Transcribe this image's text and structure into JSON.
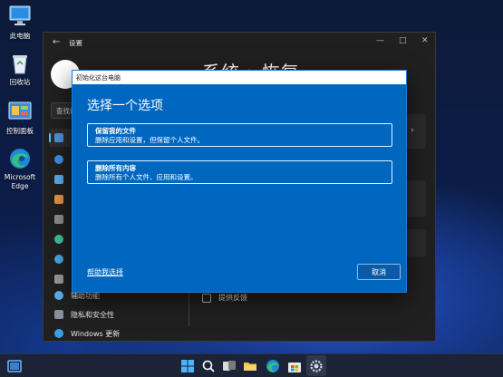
{
  "desktop": {
    "icons": [
      {
        "label": "此电脑",
        "icon": "computer-icon"
      },
      {
        "label": "回收站",
        "icon": "recycle-bin-icon"
      },
      {
        "label": "控制面板",
        "icon": "control-panel-icon"
      },
      {
        "label": "Microsoft Edge",
        "icon": "edge-icon"
      }
    ]
  },
  "settings_window": {
    "title": "设置",
    "heading": "系统 › 恢复",
    "search_value": "查找设",
    "nav_items": [
      {
        "label": "辅助功能",
        "icon": "accessibility-icon"
      },
      {
        "label": "隐私和安全性",
        "icon": "shield-icon"
      },
      {
        "label": "Windows 更新",
        "icon": "windows-update-icon"
      }
    ],
    "feedback_label": "提供反馈",
    "colors": {
      "background": "#202020",
      "accent": "#4cc2ff"
    }
  },
  "dialog": {
    "titlebar": "初始化这台电脑",
    "heading": "选择一个选项",
    "options": [
      {
        "title": "保留我的文件",
        "desc": "删除应用和设置，但保留个人文件。"
      },
      {
        "title": "删除所有内容",
        "desc": "删除所有个人文件、应用和设置。"
      }
    ],
    "help_link": "帮助我选择",
    "cancel_label": "取消",
    "colors": {
      "background": "#0067c0"
    }
  },
  "taskbar": {
    "icons": [
      "show-desktop-icon",
      "start-icon",
      "search-icon",
      "task-view-icon",
      "file-explorer-icon",
      "edge-icon",
      "store-icon",
      "settings-icon"
    ]
  }
}
